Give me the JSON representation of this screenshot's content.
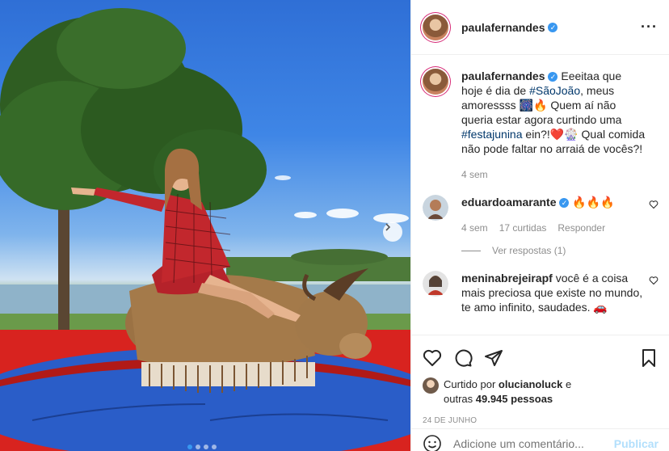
{
  "post": {
    "username": "paulafernandes",
    "verified_icon": "verified-badge-icon",
    "more_icon": "more-options-icon"
  },
  "caption": {
    "username": "paulafernandes",
    "text_1": " Eeeitaa que hoje é dia de ",
    "tag_1": "#SãoJoão",
    "text_2": ", meus amoressss 🎆🔥 Quem aí não queria estar agora curtindo uma ",
    "tag_2": "#festajunina",
    "text_3": " ein?!❤️🎡 Qual comida não pode faltar no arraiá de vocês?!",
    "time": "4 sem"
  },
  "comments": [
    {
      "username": "eduardoamarante",
      "text": " 🔥🔥🔥",
      "time": "4 sem",
      "likes": "17 curtidas",
      "reply": "Responder",
      "view_replies": "Ver respostas (1)"
    },
    {
      "username": "meninabrejeirapf",
      "text": " você é a coisa mais preciosa que existe no mundo, te amo infinito, saudades. 🚗"
    }
  ],
  "likes": {
    "prefix": "Curtido por ",
    "user": "olucianoluck",
    "middle": " e",
    "others_prefix": "outras ",
    "others_count": "49.945 pessoas"
  },
  "date": "24 DE JUNHO",
  "add_comment": {
    "placeholder": "Adicione um comentário...",
    "publish": "Publicar"
  },
  "colors": {
    "accent": "#3897f0",
    "hashtag": "#00376b",
    "muted": "#8e8e8e",
    "publish_disabled": "#b2dffc"
  },
  "carousel": {
    "total": 4,
    "active": 1
  }
}
